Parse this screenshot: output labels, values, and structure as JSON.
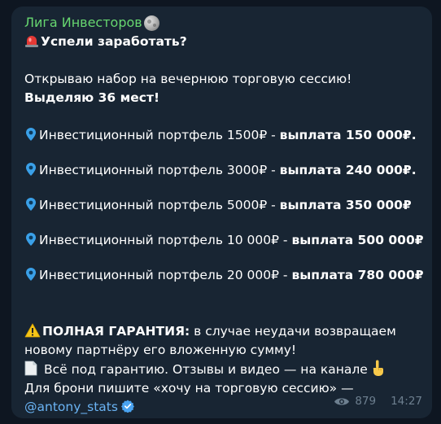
{
  "message": {
    "author": "Лига Инвесторов",
    "headline": "Успели заработать?",
    "intro_text": "Открываю набор на вечернюю торговую сессию! ",
    "intro_bold": "Выделяю 36 мест!",
    "portfolios": [
      {
        "text": "Инвестиционный портфель 1500₽ - ",
        "payout": "выплата 150 000₽."
      },
      {
        "text": "Инвестиционный портфель 3000₽ - ",
        "payout": "выплата 240 000₽."
      },
      {
        "text": "Инвестиционный портфель 5000₽ - ",
        "payout": "выплата 350 000₽"
      },
      {
        "text": "Инвестиционный портфель 10 000₽ - ",
        "payout": "выплата 500 000₽"
      },
      {
        "text": "Инвестиционный портфель 20 000₽ - ",
        "payout": "выплата 780 000₽"
      }
    ],
    "guarantee_bold": "ПОЛНАЯ ГАРАНТИЯ:",
    "guarantee_text": " в случае неудачи возвращаем новому партнёру его вложенную сумму!",
    "reviews_text": "Всё под гарантию. Отзывы и видео — на канале",
    "booking_text": "Для брони пишите «хочу на торговую сессию» —",
    "contact_link": "@antony_stats",
    "views": "879",
    "time": "14:27"
  },
  "icons": {
    "author_emoji": "full-moon-icon",
    "headline_emoji": "siren-icon",
    "list_emoji": "round-pushpin-icon",
    "guarantee_emoji": "warning-icon",
    "reviews_emoji": "page-icon",
    "reviews_end_emoji": "pointing-up-hand-icon",
    "contact_badge": "verified-badge-icon",
    "views_icon": "eye-icon"
  },
  "colors": {
    "background": "#0e1621",
    "bubble": "#182533",
    "author": "#67d770",
    "link": "#6ab3f3",
    "meta": "#6d7f8f"
  }
}
